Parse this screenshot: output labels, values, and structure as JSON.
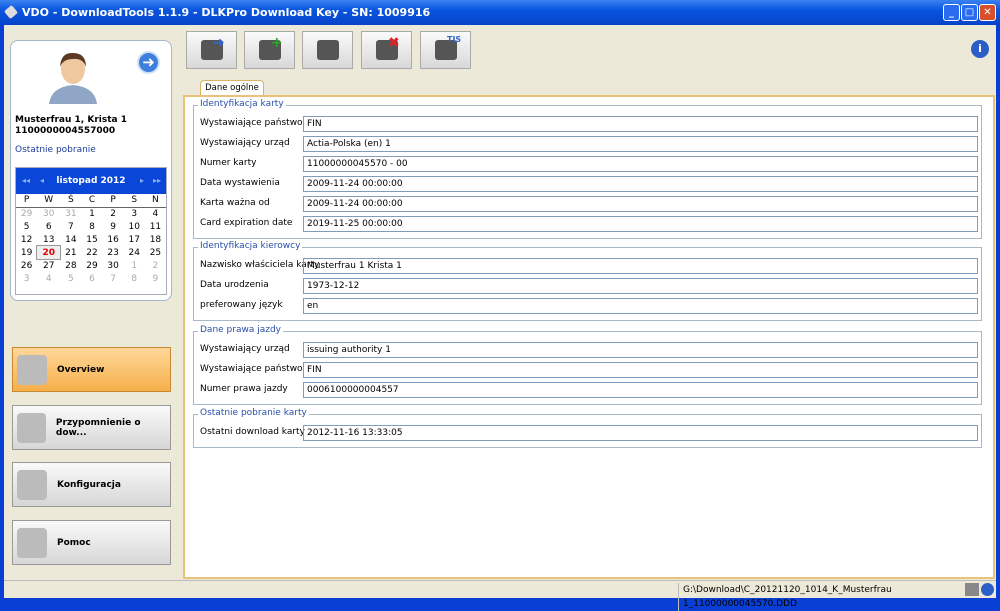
{
  "window": {
    "title": "VDO - DownloadTools 1.1.9 - DLKPro Download Key - SN: 1009916"
  },
  "user": {
    "name": "Musterfrau 1, Krista 1",
    "card": "1100000004557000",
    "last_download_label": "Ostatnie pobranie"
  },
  "calendar": {
    "month": "listopad 2012",
    "weekdays": [
      "P",
      "W",
      "Ś",
      "C",
      "P",
      "S",
      "N"
    ],
    "weeks": [
      [
        "29",
        "30",
        "31",
        "1",
        "2",
        "3",
        "4"
      ],
      [
        "5",
        "6",
        "7",
        "8",
        "9",
        "10",
        "11"
      ],
      [
        "12",
        "13",
        "14",
        "15",
        "16",
        "17",
        "18"
      ],
      [
        "19",
        "20",
        "21",
        "22",
        "23",
        "24",
        "25"
      ],
      [
        "26",
        "27",
        "28",
        "29",
        "30",
        "1",
        "2"
      ],
      [
        "3",
        "4",
        "5",
        "6",
        "7",
        "8",
        "9"
      ]
    ],
    "today": "20"
  },
  "nav": [
    {
      "label": "Overview",
      "icon": "magnifier-icon",
      "active": true
    },
    {
      "label": "Przypomnienie o dow...",
      "icon": "clock-icon"
    },
    {
      "label": "Konfiguracja",
      "icon": "gears-icon"
    },
    {
      "label": "Pomoc",
      "icon": "headset-user-icon"
    }
  ],
  "toolbar": [
    {
      "icon": "card-download-arrow-icon",
      "mark": "➜"
    },
    {
      "icon": "card-add-icon",
      "mark": "+"
    },
    {
      "icon": "card-list-icon",
      "mark": ""
    },
    {
      "icon": "card-delete-icon",
      "mark": "✖"
    },
    {
      "icon": "tis-globe-icon",
      "mark": "TIS"
    }
  ],
  "tab": "Dane ogólne",
  "groups": [
    {
      "title": "Identyfikacja karty",
      "rows": [
        [
          "Wystawiające państwo",
          "FIN"
        ],
        [
          "Wystawiający urząd",
          "Actia-Polska (en) 1"
        ],
        [
          "Numer karty",
          "11000000045570 - 00"
        ],
        [
          "Data wystawienia",
          "2009-11-24 00:00:00"
        ],
        [
          "Karta ważna od",
          "2009-11-24 00:00:00"
        ],
        [
          "Card expiration date",
          "2019-11-25 00:00:00"
        ]
      ]
    },
    {
      "title": "Identyfikacja kierowcy",
      "rows": [
        [
          "Nazwisko właściciela karty",
          "Musterfrau 1 Krista 1"
        ],
        [
          "Data urodzenia",
          "1973-12-12"
        ],
        [
          "preferowany język",
          "en"
        ]
      ]
    },
    {
      "title": "Dane prawa jazdy",
      "rows": [
        [
          "Wystawiający urząd",
          "issuing authority 1"
        ],
        [
          "Wystawiające państwo",
          "FIN"
        ],
        [
          "Numer prawa jazdy",
          "0006100000004557"
        ]
      ]
    },
    {
      "title": "Ostatnie pobranie karty",
      "rows": [
        [
          "Ostatni download karty",
          "2012-11-16 13:33:05"
        ]
      ]
    }
  ],
  "status": {
    "path": "G:\\Download\\C_20121120_1014_K_Musterfrau 1_11000000045570.DDD"
  },
  "colors": {
    "title": "#0a55e0",
    "active_nav": "#f6b04a",
    "today": "#dd0000"
  }
}
